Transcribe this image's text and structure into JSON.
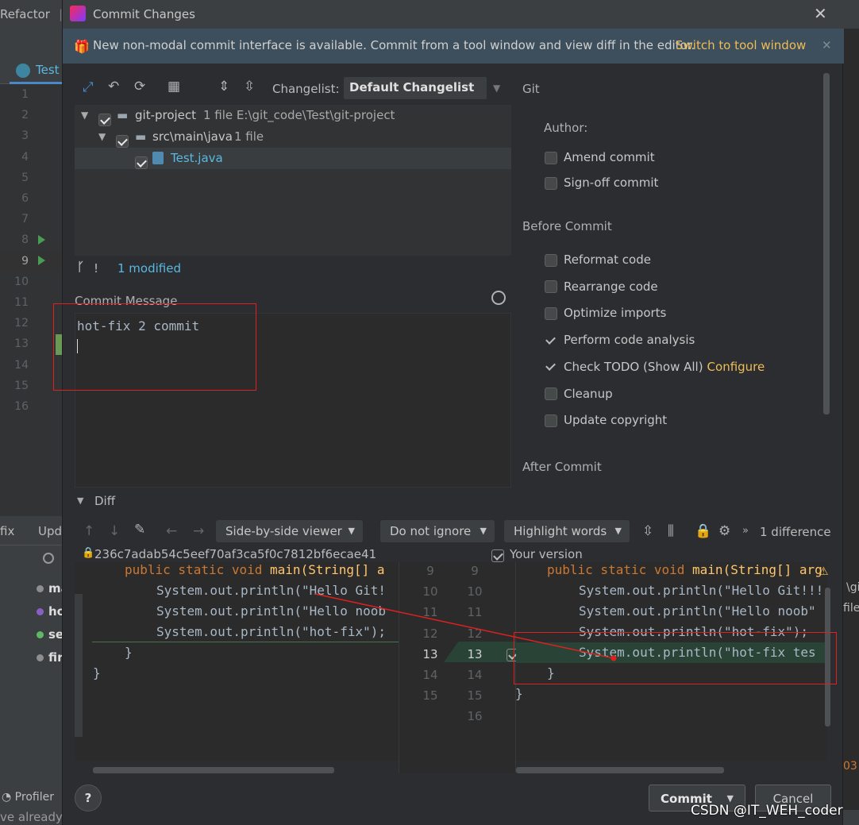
{
  "ide": {
    "menu_refactor": "Refactor",
    "menu_sep": "|",
    "tab_test": "Test",
    "line_numbers": [
      "1",
      "2",
      "3",
      "4",
      "5",
      "6",
      "7",
      "8",
      "9",
      "10",
      "11",
      "12",
      "13",
      "14",
      "15",
      "16"
    ],
    "bottom_tab_fix": "fix",
    "bottom_tab_upd": "Upd",
    "branches": [
      "ma",
      "ho",
      "se",
      "fir"
    ],
    "profiler": "Profiler",
    "status_text": "ve already been reverted (a minute ago)",
    "right_texts": [
      "\\gi",
      "file",
      "03"
    ]
  },
  "dialog": {
    "title": "Commit Changes",
    "banner_text": "New non-modal commit interface is available. Commit from a tool window and view diff in the editor.",
    "banner_link": "Switch to tool window",
    "changelist_label": "Changelist:",
    "changelist_value": "Default Changelist",
    "tree": [
      {
        "name": "git-project",
        "meta": "1 file  E:\\git_code\\Test\\git-project"
      },
      {
        "name": "src\\main\\java",
        "meta": "1 file"
      },
      {
        "name": "Test.java",
        "meta": ""
      }
    ],
    "modified_summary": "1 modified",
    "commit_message_label": "Commit Message",
    "commit_message": "hot-fix 2 commit",
    "git_section": "Git",
    "author_label": "Author:",
    "git_options": [
      "Amend commit",
      "Sign-off commit"
    ],
    "before_commit_section": "Before Commit",
    "before_options": [
      {
        "label": "Reformat code",
        "checked": false
      },
      {
        "label": "Rearrange code",
        "checked": false
      },
      {
        "label": "Optimize imports",
        "checked": false
      },
      {
        "label": "Perform code analysis",
        "checked": true
      },
      {
        "label": "Check TODO (Show All)",
        "checked": true,
        "link": "Configure"
      },
      {
        "label": "Cleanup",
        "checked": false
      },
      {
        "label": "Update copyright",
        "checked": false
      }
    ],
    "after_commit_section": "After Commit",
    "diff": {
      "title": "Diff",
      "viewer": "Side-by-side viewer",
      "ignore": "Do not ignore",
      "highlight": "Highlight words",
      "differences": "1 difference",
      "left_hash": "236c7adab54c5eef70af3ca5f0c7812bf6ecae41",
      "right_label": "Your version",
      "left_lines": [
        "9",
        "10",
        "11",
        "12",
        "13",
        "14",
        "15"
      ],
      "right_lines": [
        "9",
        "10",
        "11",
        "12",
        "13",
        "14",
        "15",
        "16"
      ],
      "left_code": {
        "l1a": "public static void ",
        "l1b": "main(String[] a",
        "l2": "System.out.println(\"Hello Git!",
        "l3": "System.out.println(\"Hello noob",
        "l4": "System.out.println(\"hot-fix\");",
        "l5": "}",
        "l6": "}"
      },
      "right_code": {
        "l1a": "public static void ",
        "l1b": "main(String[] arg",
        "l2": "System.out.println(\"Hello Git!!!",
        "l3": "System.out.println(\"Hello noob\"",
        "l4": "System.out.println(\"hot-fix\");",
        "l5": "System.out.println(\"hot-fix tes",
        "l6": "}",
        "l7": "}"
      }
    },
    "help": "?",
    "commit_button": "Commit",
    "cancel_button": "Cancel"
  },
  "watermark": "CSDN @IT_WEH_coder",
  "colors": {
    "annotation_red": "#e0201f",
    "link": "#eebd57",
    "tree_link": "#59b9e0",
    "added": "#294436"
  }
}
